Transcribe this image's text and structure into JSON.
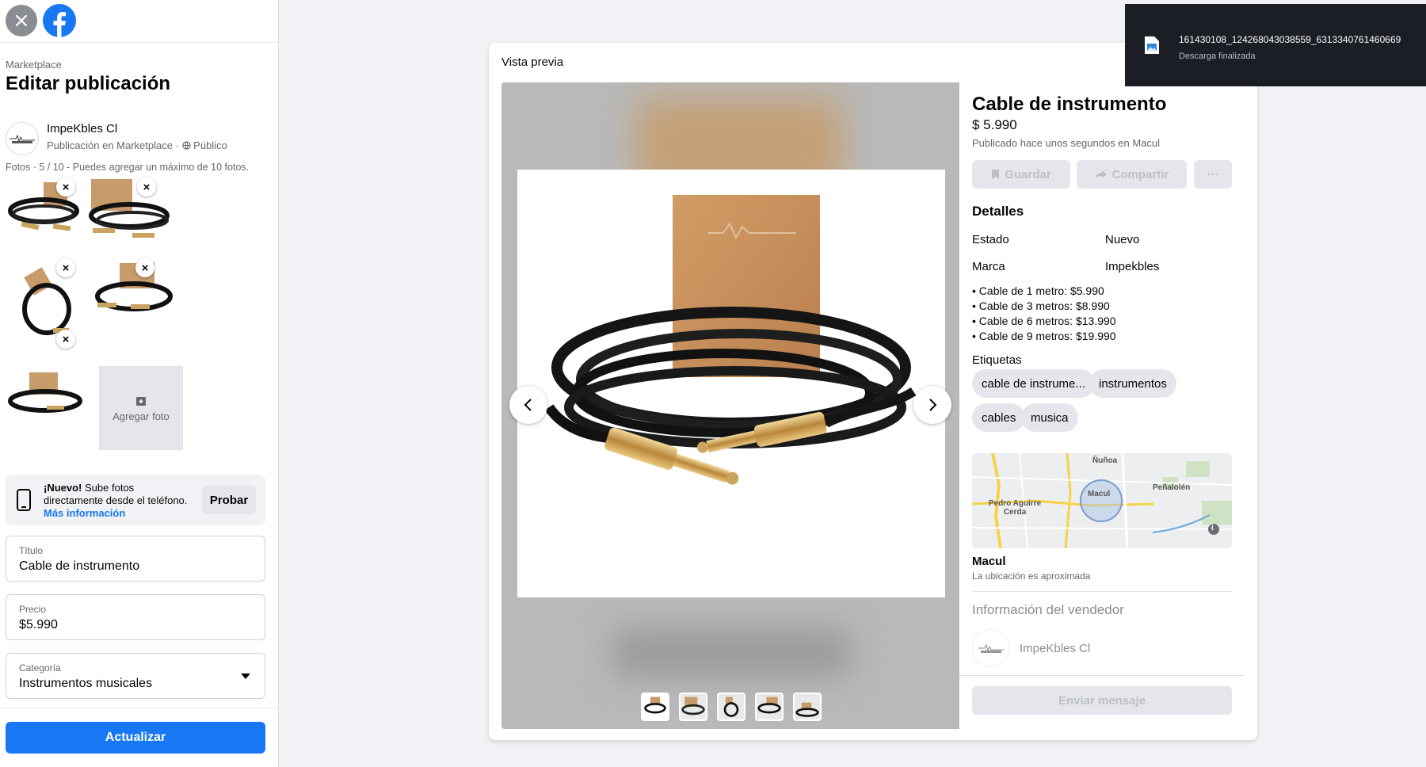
{
  "sidebar": {
    "section_label": "Marketplace",
    "title": "Editar publicación",
    "seller": {
      "name": "ImpeKbles Cl",
      "subtitle": "Publicación en Marketplace ·",
      "audience": "Público"
    },
    "photos": {
      "label": "Fotos",
      "count": "5 / 10",
      "hint": "Puedes agregar un máximo de 10 fotos."
    },
    "add_photo_label": "Agregar foto",
    "promo": {
      "new_label": "¡Nuevo!",
      "text": "Sube fotos directamente desde el teléfono.",
      "link": "Más información",
      "button": "Probar"
    },
    "fields": {
      "title": {
        "label": "Título",
        "value": "Cable de instrumento"
      },
      "price": {
        "label": "Precio",
        "value": "$5.990"
      },
      "category": {
        "label": "Categoría",
        "value": "Instrumentos musicales"
      }
    },
    "update_button": "Actualizar"
  },
  "preview": {
    "header": "Vista previa",
    "product_title": "Cable de instrumento",
    "price": "$ 5.990",
    "published": "Publicado hace unos segundos en Macul",
    "actions": {
      "save": "Guardar",
      "share": "Compartir",
      "more": "···"
    },
    "details_title": "Detalles",
    "details": [
      {
        "key": "Estado",
        "value": "Nuevo"
      },
      {
        "key": "Marca",
        "value": "Impekbles"
      }
    ],
    "bullets": [
      "• Cable de 1 metro: $5.990",
      "• Cable de 3 metros: $8.990",
      "• Cable de 6 metros: $13.990",
      "• Cable de 9 metros: $19.990"
    ],
    "tags_title": "Etiquetas",
    "tags": [
      "cable de instrume...",
      "instrumentos",
      "cables",
      "musica"
    ],
    "map_labels": {
      "a": "Ñuñoa",
      "b": "Peñalolén",
      "c": "Pedro Aguirre Cerda",
      "d": "Macul",
      "info": "i"
    },
    "location": "Macul",
    "location_note": "La ubicación es aproximada",
    "seller_section": "Información del vendedor",
    "seller_name": "ImpeKbles Cl",
    "send_button": "Enviar mensaje"
  },
  "download": {
    "filename": "161430108_124268043038559_6313340761460669",
    "status": "Descarga finalizada"
  },
  "colors": {
    "accent": "#1877f2",
    "toast_bg": "#1c1e26",
    "panel_bg": "#f0f2f5"
  }
}
